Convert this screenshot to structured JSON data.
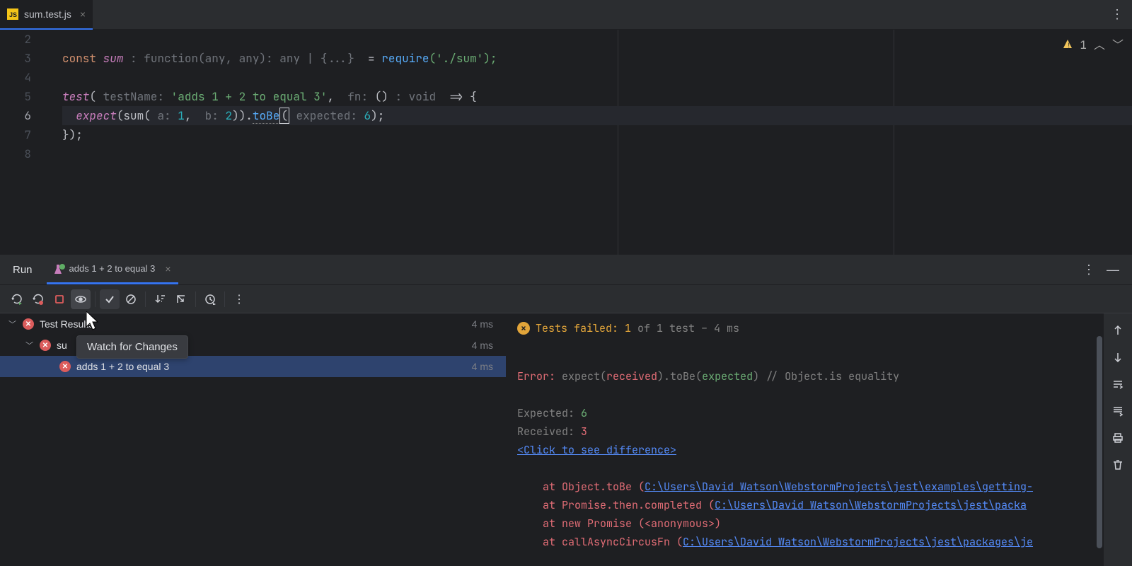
{
  "tab": {
    "filename": "sum.test.js"
  },
  "editor": {
    "lines": [
      "2",
      "3",
      "4",
      "5",
      "6",
      "7",
      "8"
    ],
    "currentLine": "6",
    "warnings": "1",
    "code": {
      "const": "const",
      "sum": "sum",
      "typeHint1": ": function(any, any): any | {...}",
      "eq": "  = ",
      "require": "require",
      "requireArg": "('./sum');",
      "test": "test",
      "testNameHint": "testName:",
      "testNameStr": "'adds 1 + 2 to equal 3'",
      "comma1": ", ",
      "fnHint": "fn:",
      "arrow": "() ",
      "voidHint": ": void",
      "arrowTail": "  => {",
      "expect": "expect",
      "sumCall": "(sum(",
      "aHint": "a:",
      "aVal": "1",
      "bHint": "b:",
      "bVal": "2",
      "closeSum": ")).",
      "toBe": "toBe",
      "openExpected": "(",
      "expectedHint": "expected:",
      "expectedVal": "6",
      "closeExpected": ");",
      "closeBrace": "});"
    }
  },
  "runPanel": {
    "title": "Run",
    "runTab": "adds 1 + 2 to equal 3"
  },
  "tooltip": "Watch for Changes",
  "tree": {
    "root": {
      "name": "Test Results",
      "time": "4 ms"
    },
    "suite": {
      "name": "su",
      "time": "4 ms"
    },
    "test": {
      "name": "adds 1 + 2 to equal 3",
      "time": "4 ms"
    }
  },
  "output": {
    "statusPrefix": "Tests failed: 1",
    "statusRest": " of 1 test – 4 ms",
    "errorLabel": "Error: ",
    "expectCall": "expect(",
    "received": "received",
    "toBeCall": ").toBe(",
    "expected": "expected",
    "closeParen": ")",
    "comment": " // Object.is equality",
    "expectedLabel": "Expected: ",
    "expectedValue": "6",
    "receivedLabel": "Received: ",
    "receivedValue": "3",
    "diffLink": "<Click to see difference>",
    "trace1a": "    at Object.toBe (",
    "trace1b": "C:\\Users\\David Watson\\WebstormProjects\\jest\\examples\\getting-",
    "trace2a": "    at Promise.then.completed (",
    "trace2b": "C:\\Users\\David Watson\\WebstormProjects\\jest\\packa",
    "trace3": "    at new Promise (<anonymous>)",
    "trace4a": "    at callAsyncCircusFn (",
    "trace4b": "C:\\Users\\David Watson\\WebstormProjects\\jest\\packages\\je"
  }
}
